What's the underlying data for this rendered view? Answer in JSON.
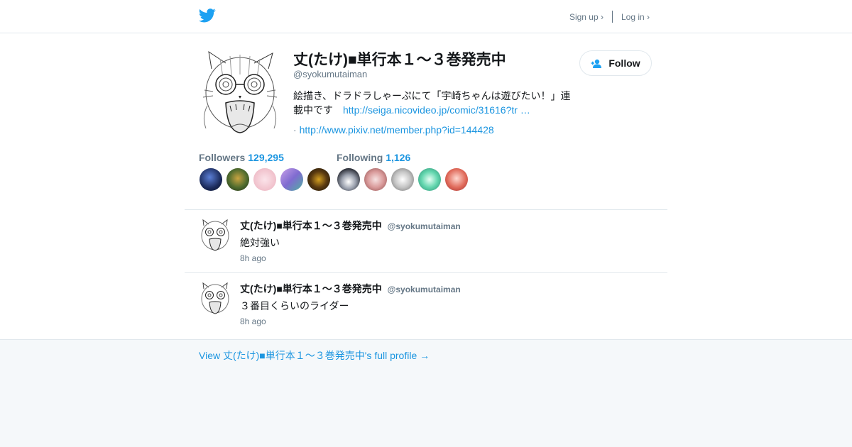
{
  "header": {
    "logo_icon": "twitter-bird-icon",
    "signup_label": "Sign up ›",
    "login_label": "Log in ›"
  },
  "profile": {
    "name": "丈(たけ)■単行本１～３巻発売中",
    "handle": "@syokumutaiman",
    "bio_text": "絵描き、ドラドラしゃーぷにて「宇崎ちゃんは遊びたい！」連載中です",
    "bio_link": "http://seiga.nicovideo.jp/comic/31616?tr …",
    "link_prefix": "·",
    "link": "http://www.pixiv.net/member.php?id=144428",
    "follow_label": "Follow"
  },
  "stats": {
    "followers_label": "Followers",
    "followers_count": "129,295",
    "following_label": "Following",
    "following_count": "1,126"
  },
  "tweets": [
    {
      "name": "丈(たけ)■単行本１～３巻発売中",
      "handle": "@syokumutaiman",
      "text": "絶対強い",
      "time": "8h ago"
    },
    {
      "name": "丈(たけ)■単行本１～３巻発売中",
      "handle": "@syokumutaiman",
      "text": "３番目くらいのライダー",
      "time": "8h ago"
    }
  ],
  "footer": {
    "full_profile_label": "View 丈(たけ)■単行本１～３巻発売中's full profile →"
  },
  "colors": {
    "accent": "#1b95e0",
    "muted": "#657786",
    "twitter_blue": "#1da1f2"
  }
}
